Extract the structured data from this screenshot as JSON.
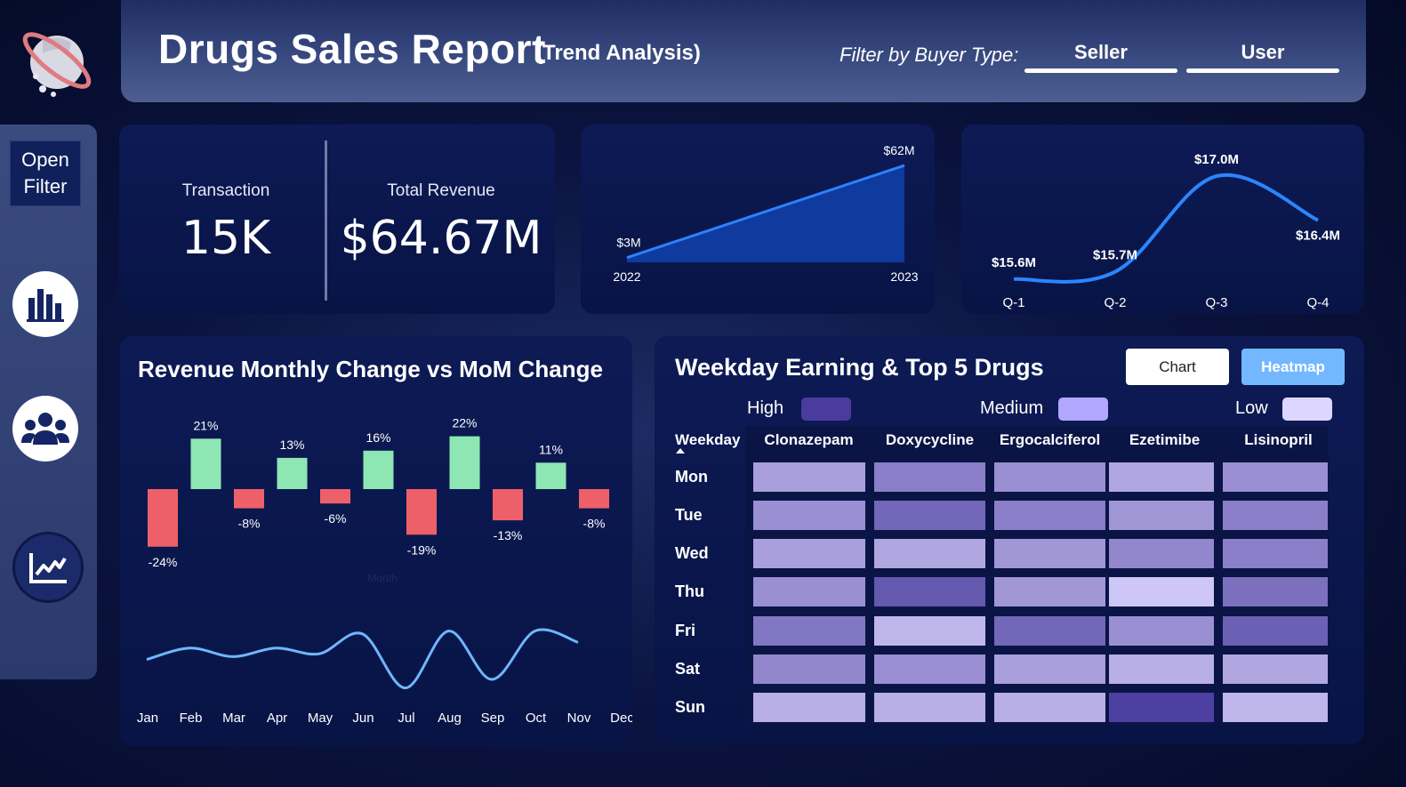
{
  "header": {
    "title": "Drugs Sales Report",
    "subtitle": "(Trend Analysis)",
    "filter_label": "Filter by Buyer Type:",
    "filter_options": [
      "Seller",
      "User"
    ]
  },
  "sidebar": {
    "open_filter": [
      "Open",
      "Filter"
    ],
    "icons": [
      "bar-chart-icon",
      "users-group-icon",
      "trend-line-icon"
    ]
  },
  "kpis": {
    "transaction_label": "Transaction",
    "transaction_value": "15K",
    "revenue_label": "Total Revenue",
    "revenue_value": "$64.67M"
  },
  "chart_data": [
    {
      "type": "area",
      "x": [
        "2022",
        "2023"
      ],
      "values": [
        3,
        62
      ],
      "data_labels": [
        "$3M",
        "$62M"
      ]
    },
    {
      "type": "line",
      "x": [
        "Q-1",
        "Q-2",
        "Q-3",
        "Q-4"
      ],
      "values": [
        15.6,
        15.7,
        17.0,
        16.4
      ],
      "data_labels": [
        "$15.6M",
        "$15.7M",
        "$17.0M",
        "$16.4M"
      ]
    },
    {
      "type": "bar",
      "title": "Revenue Monthly Change vs MoM Change",
      "categories": [
        "Jan",
        "Feb",
        "Mar",
        "Apr",
        "May",
        "Jun",
        "Jul",
        "Aug",
        "Sep",
        "Oct",
        "Nov",
        "Dec"
      ],
      "values": [
        -24,
        21,
        -8,
        13,
        -6,
        16,
        -19,
        22,
        -13,
        11,
        -8
      ],
      "data_labels": [
        "-24%",
        "21%",
        "-8%",
        "13%",
        "-6%",
        "16%",
        "-19%",
        "22%",
        "-13%",
        "11%",
        "-8%"
      ],
      "xlabel": "Month",
      "line_series": [
        -13,
        -9,
        -12,
        -9,
        -11,
        -4,
        -23,
        -3,
        -20,
        -3,
        -7
      ]
    },
    {
      "type": "heatmap",
      "title": "Weekday Earning & Top 5 Drugs",
      "row_header": "Weekday",
      "rows": [
        "Mon",
        "Tue",
        "Wed",
        "Thu",
        "Fri",
        "Sat",
        "Sun"
      ],
      "columns": [
        "Clonazepam",
        "Doxycycline",
        "Ergocalciferol",
        "Ezetimibe",
        "Lisinopril"
      ],
      "values": [
        [
          0.35,
          0.55,
          0.45,
          0.3,
          0.45
        ],
        [
          0.45,
          0.7,
          0.55,
          0.4,
          0.55
        ],
        [
          0.35,
          0.3,
          0.4,
          0.5,
          0.55
        ],
        [
          0.45,
          0.8,
          0.4,
          0.1,
          0.65
        ],
        [
          0.6,
          0.2,
          0.7,
          0.45,
          0.75
        ],
        [
          0.5,
          0.45,
          0.35,
          0.25,
          0.3
        ],
        [
          0.25,
          0.25,
          0.25,
          0.95,
          0.2
        ]
      ]
    }
  ],
  "heatmap_legend": [
    "High",
    "Medium",
    "Low"
  ],
  "heatmap_toggle": [
    "Chart",
    "Heatmap"
  ],
  "colors": {
    "positive_bar": "#8ee6b3",
    "negative_bar": "#ee6069",
    "line": "#6fb6ff",
    "heat_high": "#4b3b9e",
    "heat_medium": "#b3a6ff",
    "heat_low": "#ddd6ff",
    "toggle_active": "#73b8ff"
  }
}
